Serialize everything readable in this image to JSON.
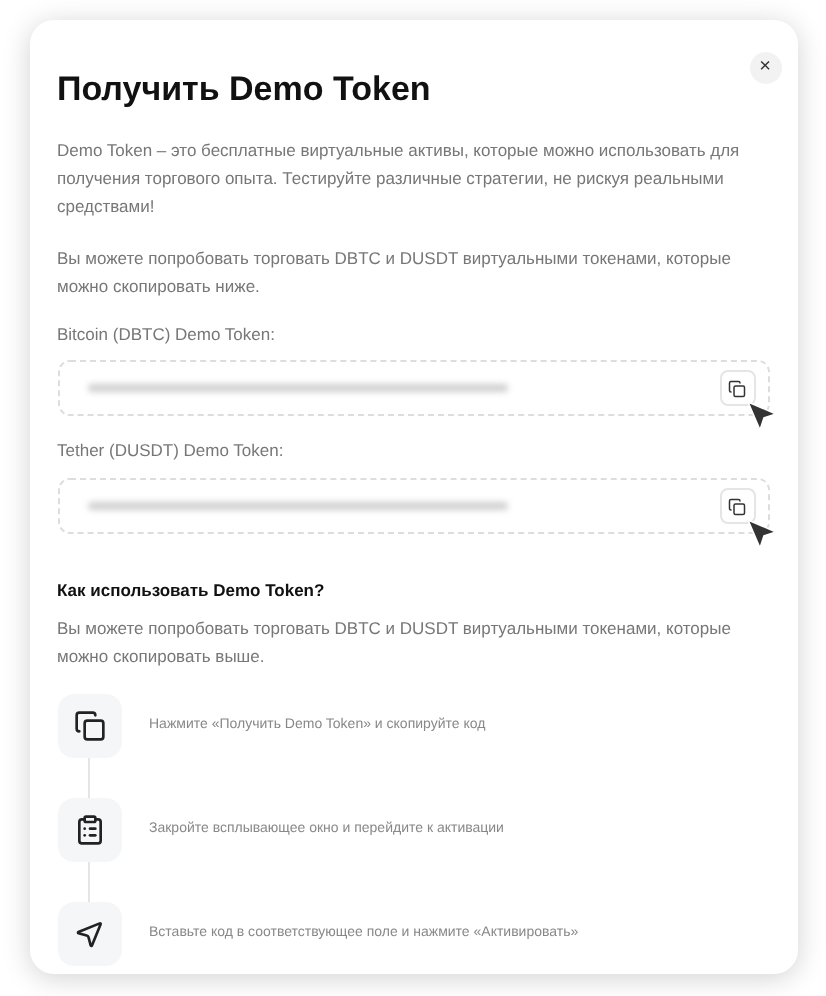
{
  "dialog": {
    "close": "×",
    "title": "Получить Demo Token",
    "intro": "Demo Token – это бесплатные виртуальные активы, которые можно использовать для получения торгового опыта. Тестируйте различные стратегии, не рискуя реальными средствами!",
    "note": "Вы можете попробовать торговать DBTC и DUSDT виртуальными токенами, которые можно скопировать ниже.",
    "tokens": [
      {
        "label": "Bitcoin (DBTC) Demo Token:"
      },
      {
        "label": "Tether (DUSDT) Demo Token:"
      }
    ],
    "howto": {
      "title": "Как использовать Demo Token?",
      "text": "Вы можете попробовать торговать DBTC и DUSDT виртуальными токенами, которые можно скопировать выше.",
      "steps": [
        {
          "kind": "copy",
          "text": "Нажмите «Получить Demo Token» и скопируйте код"
        },
        {
          "kind": "clipboard",
          "text": "Закройте всплывающее окно и перейдите к активации"
        },
        {
          "kind": "cursor",
          "text": "Вставьте код в соответствующее поле и нажмите «Активировать»"
        }
      ]
    }
  }
}
